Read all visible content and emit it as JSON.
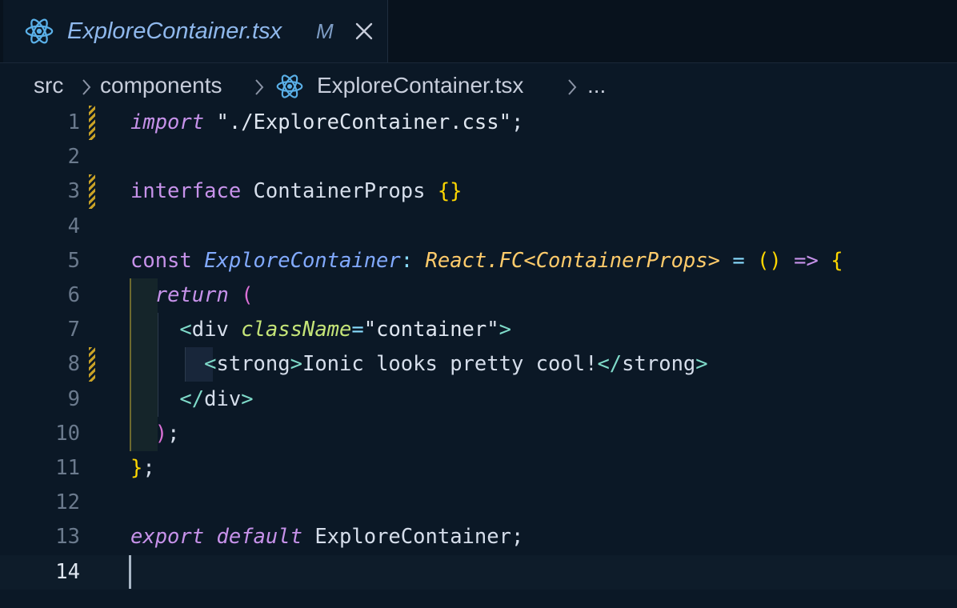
{
  "tab": {
    "filename": "ExploreContainer.tsx",
    "status": "M",
    "icon": "react-icon",
    "close_icon": "close-icon"
  },
  "breadcrumb": {
    "items": [
      "src",
      "components",
      "ExploreContainer.tsx",
      "..."
    ]
  },
  "editor": {
    "line_numbers": [
      "1",
      "2",
      "3",
      "4",
      "5",
      "6",
      "7",
      "8",
      "9",
      "10",
      "11",
      "12",
      "13",
      "14"
    ],
    "current_line": "14",
    "lines": {
      "l1": {
        "kw": "import",
        "str": "\"./ExploreContainer.css\"",
        "end": ";"
      },
      "l3": {
        "kw": "interface",
        "name": "ContainerProps",
        "braces": "{}"
      },
      "l5": {
        "kw": "const",
        "name": "ExploreContainer",
        "colon": ":",
        "type_ns": "React",
        "dot": ".",
        "type": "FC",
        "lt": "<",
        "generic": "ContainerProps",
        "gt": ">",
        "eq": "=",
        "paren": "()",
        "arrow": "=>",
        "brace": "{"
      },
      "l6": {
        "kw": "return",
        "paren": "("
      },
      "l7": {
        "open": "<",
        "tag": "div",
        "attr": "className",
        "eq": "=",
        "value": "\"container\"",
        "close": ">"
      },
      "l8": {
        "open": "<",
        "tag": "strong",
        "close": ">",
        "text": "Ionic looks pretty cool!",
        "end_open": "</",
        "end_tag": "strong",
        "end_close": ">"
      },
      "l9": {
        "end_open": "</",
        "tag": "div",
        "close": ">"
      },
      "l10": {
        "paren": ")",
        "end": ";"
      },
      "l11": {
        "brace": "}",
        "end": ";"
      },
      "l13": {
        "kw1": "export",
        "kw2": "default",
        "name": "ExploreContainer",
        "end": ";"
      }
    }
  },
  "colors": {
    "background": "#0b1826",
    "keyword": "#c792ea",
    "function": "#82aaff",
    "type": "#ffcb6b",
    "tag": "#7fdbca",
    "attribute": "#c5e478",
    "modified_gutter": "#c9a227"
  }
}
